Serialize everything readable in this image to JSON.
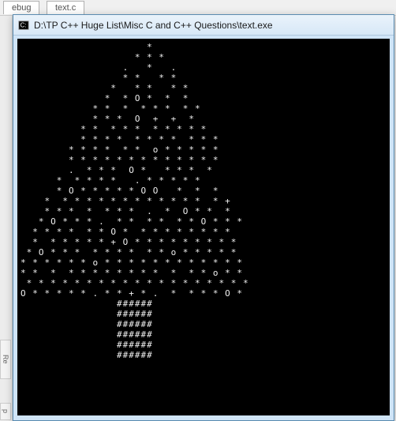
{
  "editor": {
    "tab1": "ebug",
    "tab2": "text.c"
  },
  "sidebuttons": {
    "re": "Re",
    "p": "p"
  },
  "console": {
    "title": "D:\\TP C++ Huge List\\Misc C and C++ Questions\\text.exe",
    "tree": [
      "                     *",
      "                   * * *",
      "                 .   *   .",
      "                 * *   * *",
      "               *   * *   * *",
      "              *  * O *  *  *",
      "            * *  *  * * *  * *",
      "            * * *  O  +  +  *",
      "          * *  * * *  * * * * *",
      "          * * * *  * * * *  * * *",
      "        * * * *  * *  o * * * * *",
      "        * * * * * * * * * * * * *",
      "        .  * * *  O *   * * *  *",
      "      *  * * * *   . * * * * *",
      "      * O * * * * * O O   *  *  *",
      "    *  * * * * * * * * * * * *  * +",
      "    * * *  *  * * *  .  *  O * *  *",
      "   * O * * * .  * *  * *  * * O * * *",
      "  * * * *  * * O *  * * * * * * * *",
      "  *  * * * * * + O * * * * * * * * *",
      " * O * * *  * * * *  * * o * * * * *",
      "* * * * * * o * * * * * * * * * * * *",
      "* *  *  * * * * * * * *  *  * * o * *",
      " * * * * * * * * * * * * * * * * * * *",
      "O * * * * * . * * + * .  *  * * * O *",
      "                ######",
      "                ######",
      "                ######",
      "                ######",
      "                ######",
      "                ######"
    ]
  }
}
